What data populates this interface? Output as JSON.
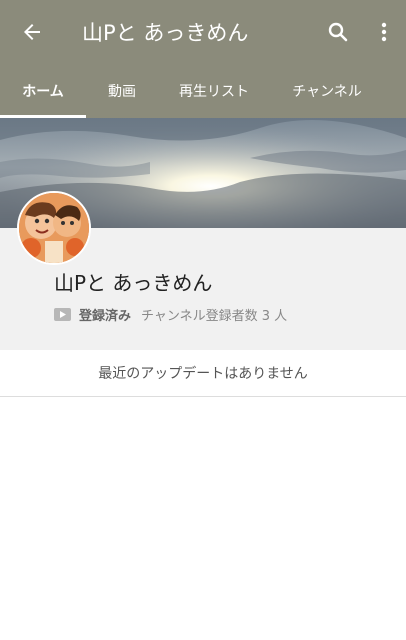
{
  "toolbar": {
    "title": "山Pと あっきめん",
    "back_icon": "arrow-left-icon",
    "search_icon": "search-icon",
    "more_icon": "more-vertical-icon"
  },
  "tabs": [
    {
      "label": "ホーム",
      "active": true
    },
    {
      "label": "動画",
      "active": false
    },
    {
      "label": "再生リスト",
      "active": false
    },
    {
      "label": "チャンネル",
      "active": false
    }
  ],
  "channel": {
    "name": "山Pと あっきめん",
    "subscribed_label": "登録済み",
    "subscriber_count": "チャンネル登録者数 3 人"
  },
  "feed": {
    "empty_message": "最近のアップデートはありません"
  },
  "colors": {
    "appbar": "#8b8b7b",
    "panel": "#f1f1f1",
    "text_primary": "#222222",
    "text_secondary": "#888888"
  }
}
